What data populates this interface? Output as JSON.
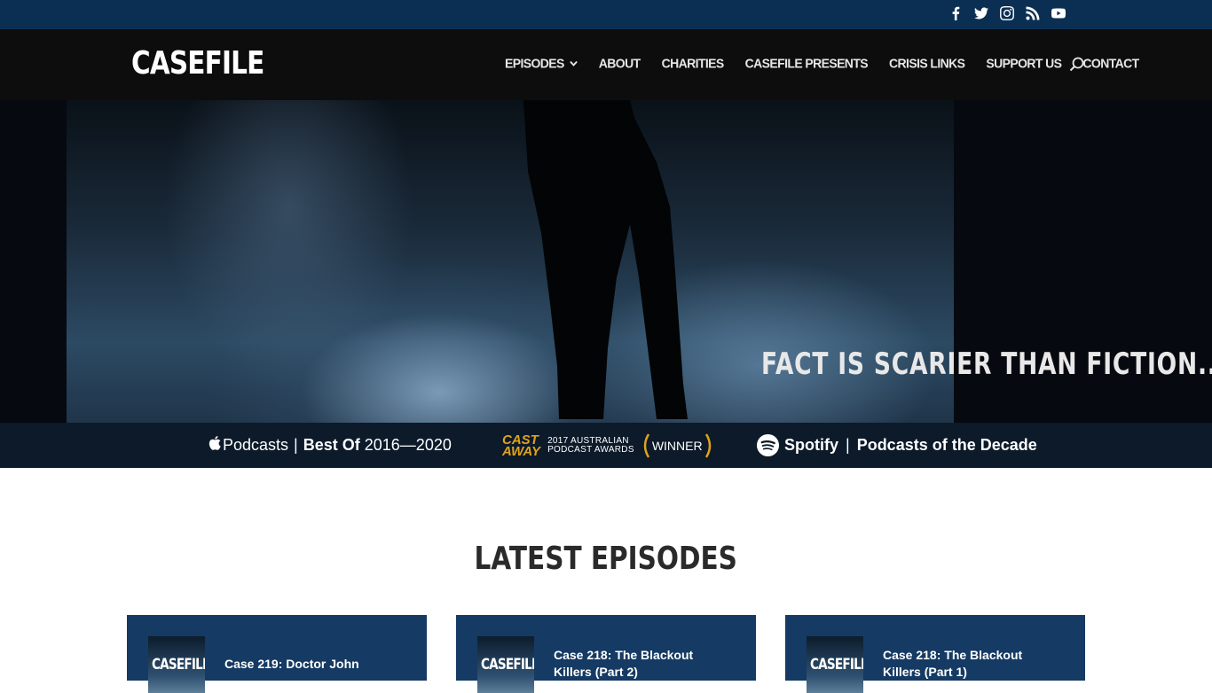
{
  "social": {
    "icons": [
      "facebook-icon",
      "twitter-icon",
      "instagram-icon",
      "rss-icon",
      "youtube-icon"
    ]
  },
  "header": {
    "logo": "CASEFILE",
    "nav": [
      {
        "label": "EPISODES",
        "has_dropdown": true
      },
      {
        "label": "ABOUT"
      },
      {
        "label": "CHARITIES"
      },
      {
        "label": "CASEFILE PRESENTS"
      },
      {
        "label": "CRISIS LINKS"
      },
      {
        "label": "SUPPORT US"
      },
      {
        "label": "CONTACT"
      }
    ]
  },
  "hero": {
    "tagline": "FACT IS SCARIER THAN FICTION..."
  },
  "awards": {
    "apple": {
      "brand": "Podcasts",
      "separator": "|",
      "bold": "Best Of",
      "years": "2016—2020"
    },
    "cast": {
      "logo_line1": "CAST",
      "logo_line2": "AWAY",
      "text_line1": "2017 AUSTRALIAN",
      "text_line2": "PODCAST AWARDS",
      "winner": "WINNER"
    },
    "spotify": {
      "brand": "Spotify",
      "separator": "|",
      "text": "Podcasts of the Decade"
    }
  },
  "latest": {
    "title": "LATEST EPISODES",
    "episodes": [
      {
        "thumb": "CASEFILE",
        "title": "Case 219: Doctor John"
      },
      {
        "thumb": "CASEFILE",
        "title": "Case 218: The Blackout Killers (Part 2)"
      },
      {
        "thumb": "CASEFILE",
        "title": "Case 218: The Blackout Killers (Part 1)"
      }
    ]
  },
  "colors": {
    "topbar": "#0b2f52",
    "header": "#0d0d0d",
    "card": "#153a63",
    "awards_strip": "#0c1a2a",
    "castaway_gold": "#e0a21c"
  }
}
